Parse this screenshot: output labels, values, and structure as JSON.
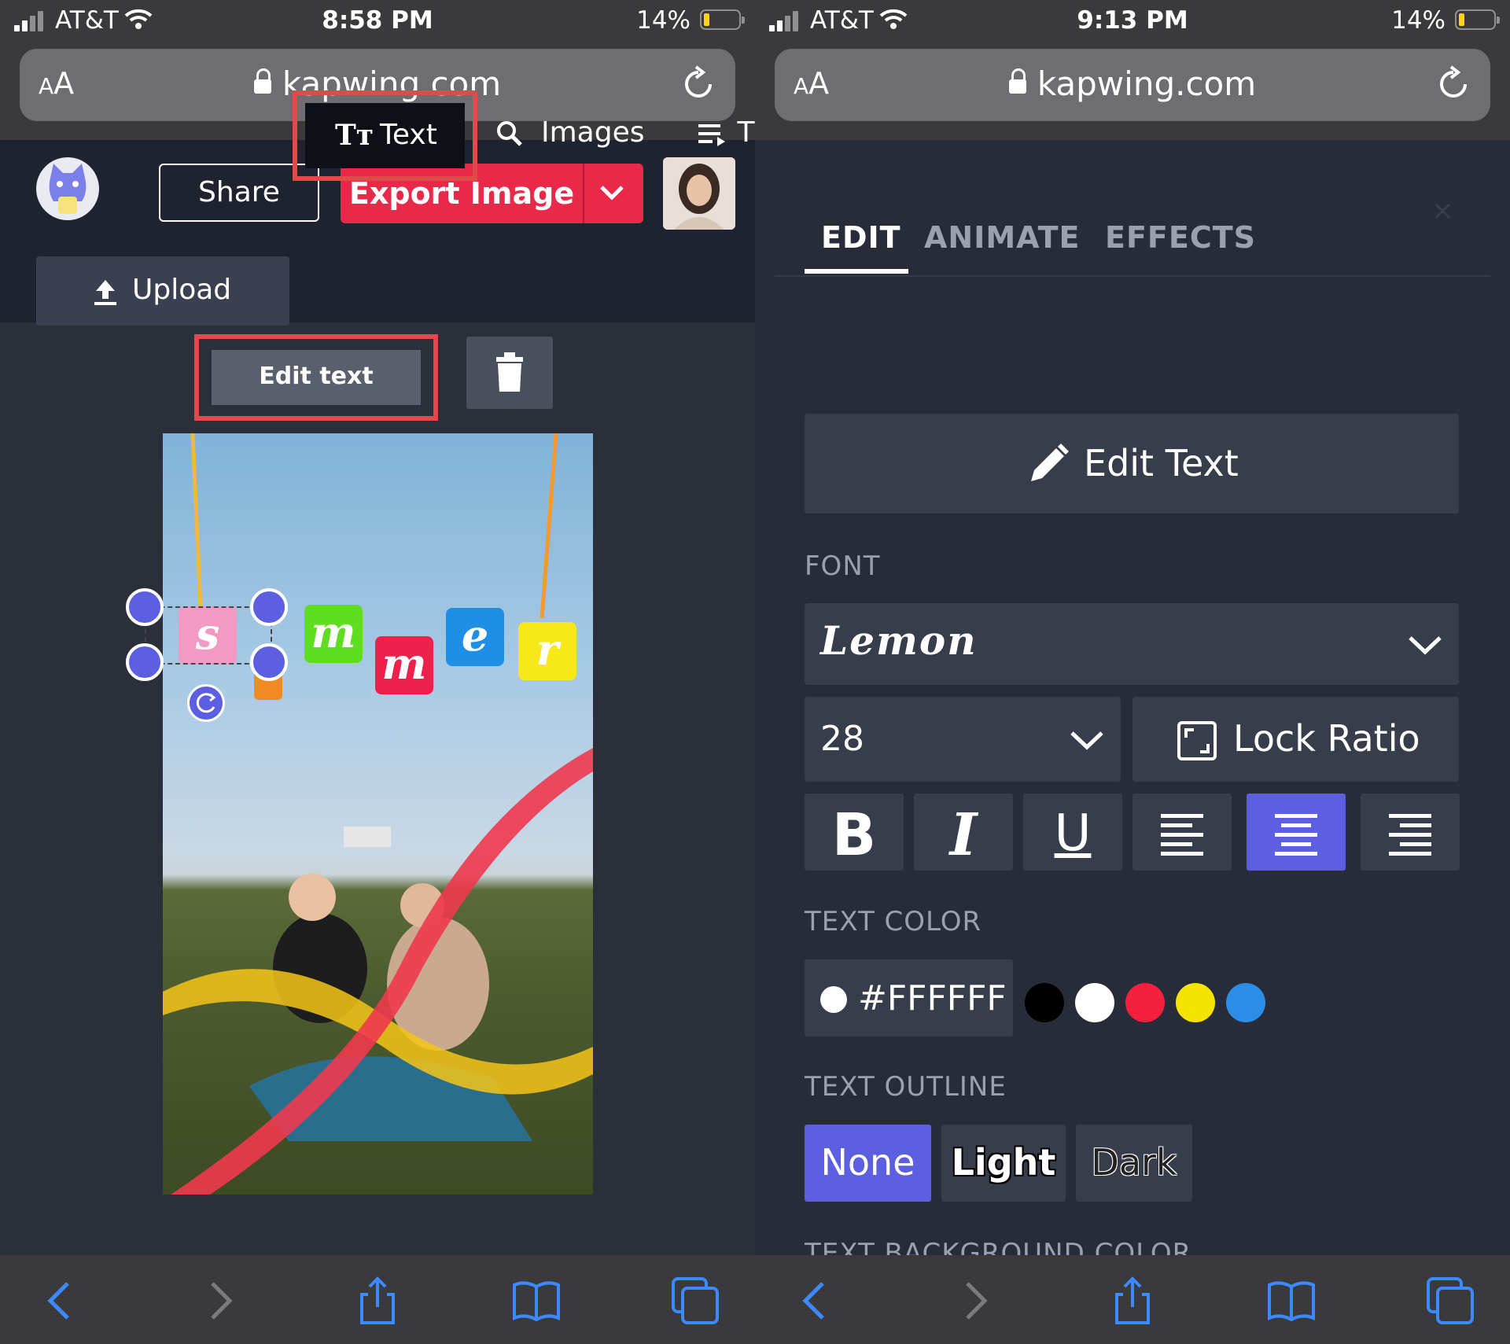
{
  "left": {
    "status": {
      "carrier": "AT&T",
      "time": "8:58 PM",
      "battery": "14%"
    },
    "url": {
      "aa_small": "A",
      "aa_big": "A",
      "domain": "kapwing.com"
    },
    "header": {
      "share_label": "Share",
      "export_label": "Export Image"
    },
    "tabs": {
      "upload": "Upload",
      "text": "Text",
      "text_glyph": "Tт",
      "images": "Images",
      "more": "T"
    },
    "edit_text_label": "Edit text",
    "canvas_letters": [
      "s",
      "m",
      "m",
      "e",
      "r"
    ]
  },
  "right": {
    "status": {
      "carrier": "AT&T",
      "time": "9:13 PM",
      "battery": "14%"
    },
    "url": {
      "aa_small": "A",
      "aa_big": "A",
      "domain": "kapwing.com"
    },
    "tabs": {
      "edit": "EDIT",
      "animate": "ANIMATE",
      "effects": "EFFECTS"
    },
    "close": "×",
    "edit_text_button": "Edit Text",
    "font_label": "FONT",
    "font_value": "Lemon",
    "size_value": "28",
    "lock_ratio": "Lock Ratio",
    "format": {
      "bold": "B",
      "italic": "I",
      "underline": "U"
    },
    "text_color_label": "TEXT COLOR",
    "text_color_value": "#FFFFFF",
    "swatches": [
      "#000000",
      "#ffffff",
      "#f5203e",
      "#f5e400",
      "#2a8de6"
    ],
    "text_outline_label": "TEXT OUTLINE",
    "outline": {
      "none": "None",
      "light": "Light",
      "dark": "Dark"
    },
    "text_bg_label": "TEXT BACKGROUND COLOR"
  },
  "colors": {
    "accent": "#5b5fe0",
    "export_red": "#e8294a",
    "highlight": "#e04a4a"
  }
}
